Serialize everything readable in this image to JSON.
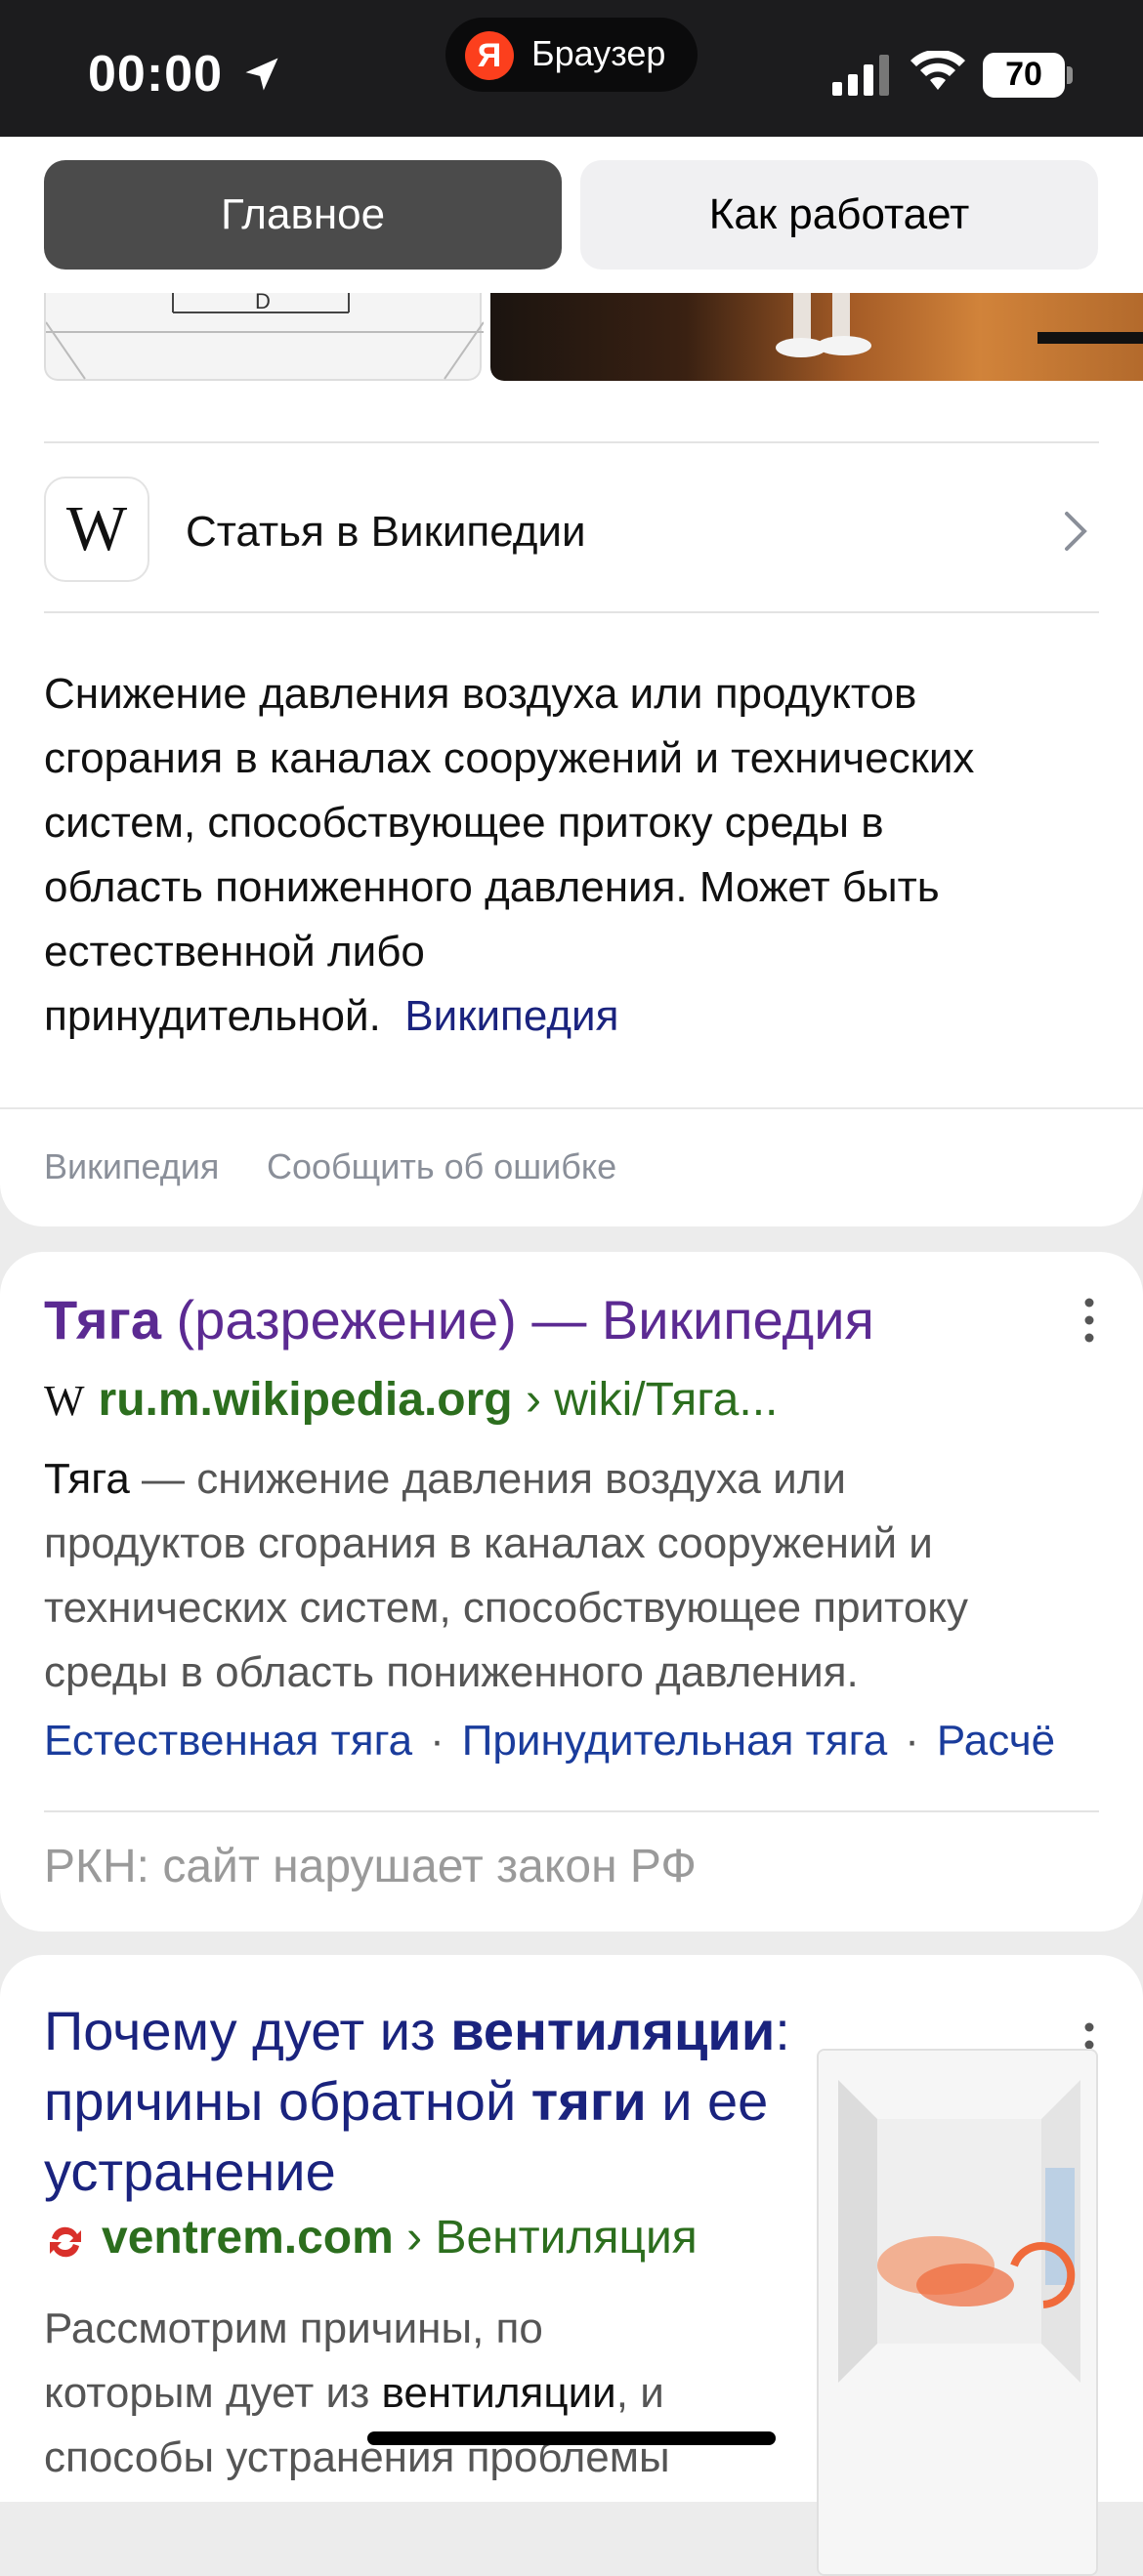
{
  "status_bar": {
    "time": "00:00",
    "app_label": "Браузер",
    "battery": "70"
  },
  "tabs": [
    {
      "label": "Главное",
      "active": true
    },
    {
      "label": "Как работает",
      "active": false
    }
  ],
  "knowledge_card": {
    "wiki_row_label": "Статья в Википедии",
    "wiki_logo": "W",
    "description": "Снижение давления воздуха или продуктов сгорания в каналах сооружений и технических систем, способствующее притоку среды в область пониженного давления. Может быть естественной либо принудительной.",
    "description_lines": [
      "Снижение давления воздуха или продуктов",
      "сгорания в каналах сооружений и технических",
      "систем, способствующее притоку среды в",
      "область пониженного давления. Может быть",
      "естественной либо",
      "принудительной."
    ],
    "source_link": "Википедия",
    "footer_links": [
      "Википедия",
      "Сообщить об ошибке"
    ]
  },
  "results": [
    {
      "title_bold": "Тяга",
      "title_rest": " (разрежение) — Википедия",
      "favicon": "W",
      "domain": "ru.m.wikipedia.org",
      "path": " › wiki/Тяга...",
      "snippet_bold": "Тяга",
      "snippet_lines": [
        " — снижение давления воздуха или",
        "продуктов сгорания в каналах сооружений и",
        "технических систем, способствующее притоку",
        "среды в область пониженного давления."
      ],
      "sitelinks": [
        "Естественная тяга",
        "Принудительная тяга",
        "Расчё"
      ],
      "notice": "РКН: сайт нарушает закон РФ"
    },
    {
      "title_parts": [
        "Почему дует из ",
        "вентиляции",
        ":",
        "причины обратной ",
        "тяги",
        " и ее",
        "устранение"
      ],
      "domain": "ventrem.com",
      "path": " › Вентиляция",
      "snippet_lines": [
        "Рассмотрим причины, по",
        "которым дует из ",
        "вентиляции",
        ", и",
        "способы устранения проблемы"
      ]
    }
  ],
  "colors": {
    "status_bg": "#1c1c1e",
    "active_tab": "#4b4b4b",
    "visited_link": "#5b2a92",
    "link": "#1a237e",
    "url_green": "#2c6e1e",
    "yandex_red": "#fc3f1d"
  },
  "icons": [
    "location-arrow-icon",
    "cellular-signal-icon",
    "wifi-icon",
    "battery-icon",
    "wikipedia-logo-icon",
    "chevron-right-icon",
    "more-dots-icon",
    "ventrem-favicon-icon"
  ]
}
